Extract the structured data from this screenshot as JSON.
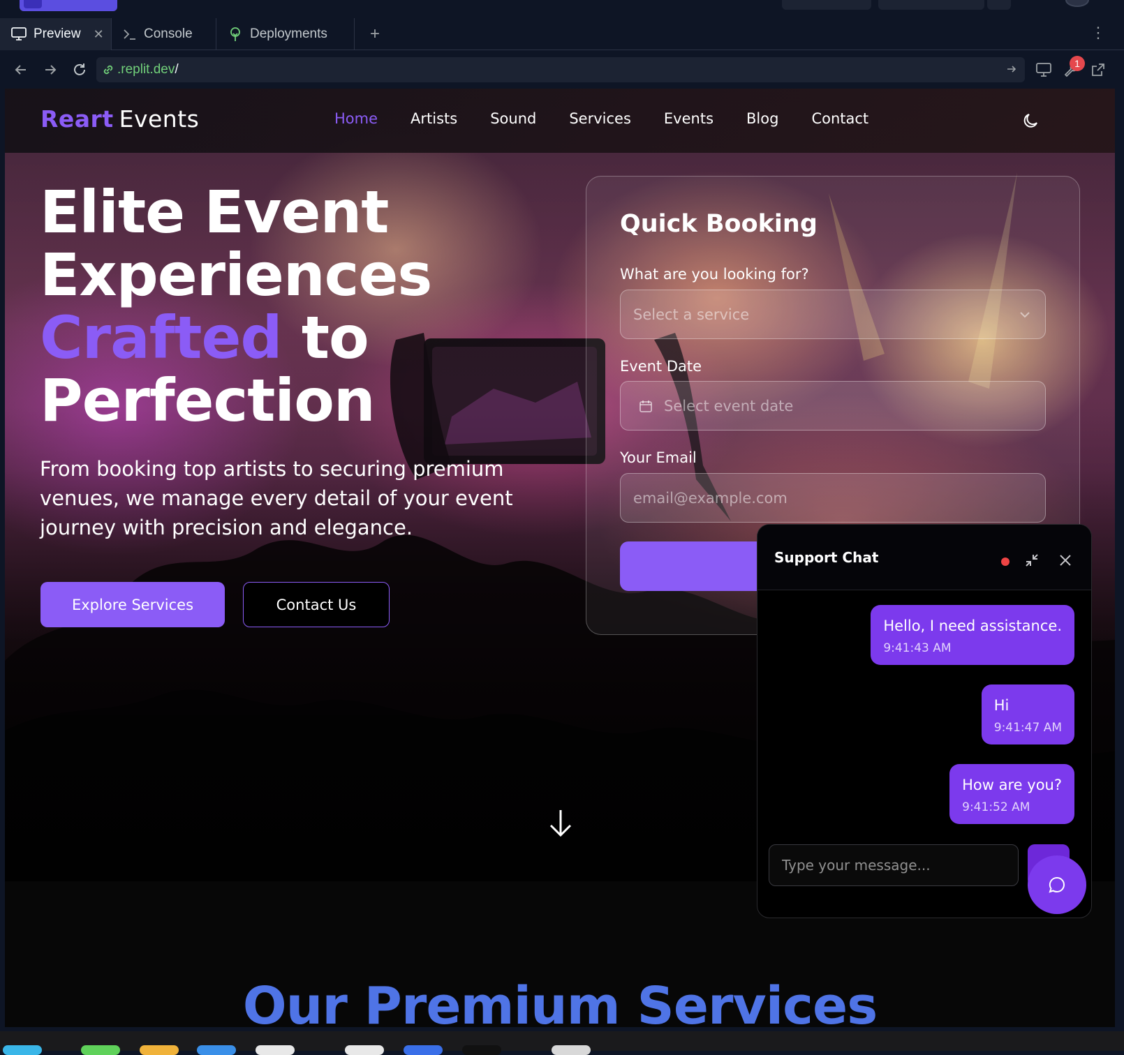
{
  "ide": {
    "tabs": [
      {
        "label": "Preview",
        "icon": "monitor-icon",
        "active": true
      },
      {
        "label": "Console",
        "icon": "terminal-icon"
      },
      {
        "label": "Deployments",
        "icon": "deploy-icon"
      }
    ],
    "url": {
      "host": ".replit.dev",
      "path": "/"
    },
    "notification_count": "1"
  },
  "site": {
    "brand": {
      "accent": "Reart",
      "rest": "Events"
    },
    "nav": [
      "Home",
      "Artists",
      "Sound",
      "Services",
      "Events",
      "Blog",
      "Contact"
    ],
    "active_nav": "Home",
    "colors": {
      "accent": "#8b5cf6",
      "section_title": "#4f74e6",
      "chat_bubble": "#7c3aed",
      "status": "#ef4444"
    }
  },
  "hero": {
    "title_line1": "Elite Event",
    "title_line2": "Experiences",
    "title_accent": "Crafted",
    "title_to": "to",
    "title_line4": "Perfection",
    "subtitle": "From booking top artists to securing premium venues, we manage every detail of your event journey with precision and elegance.",
    "primary_button": "Explore Services",
    "secondary_button": "Contact Us"
  },
  "booking": {
    "title": "Quick Booking",
    "service_label": "What are you looking for?",
    "service_placeholder": "Select a service",
    "date_label": "Event Date",
    "date_placeholder": "Select event date",
    "email_label": "Your Email",
    "email_placeholder": "email@example.com"
  },
  "section": {
    "title": "Our Premium Services"
  },
  "chat": {
    "title": "Support Chat",
    "messages": [
      {
        "text": "Hello, I need assistance.",
        "time": "9:41:43 AM"
      },
      {
        "text": "Hi",
        "time": "9:41:47 AM"
      },
      {
        "text": "How are you?",
        "time": "9:41:52 AM"
      }
    ],
    "input_placeholder": "Type your message..."
  }
}
